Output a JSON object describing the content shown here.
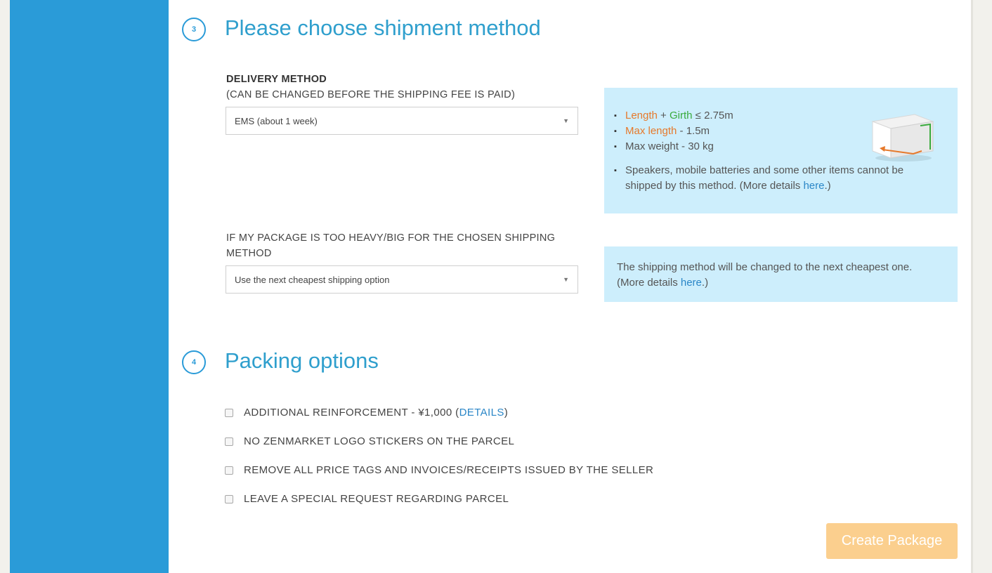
{
  "step3": {
    "number": "3",
    "title": "Please choose shipment method",
    "delivery_label": "DELIVERY METHOD",
    "delivery_sublabel": "(CAN BE CHANGED BEFORE THE SHIPPING FEE IS PAID)",
    "delivery_value": "EMS (about 1 week)",
    "info": {
      "length": "Length",
      "plus": " + ",
      "girth": "Girth",
      "length_girth_value": " ≤ 2.75m",
      "max_length_label": "Max length",
      "max_length_value": " -  1.5m",
      "max_weight": "Max weight - 30 kg",
      "restriction_text": "Speakers, mobile batteries and some other items cannot be shipped by this method. (More details ",
      "restriction_link": "here",
      "restriction_end": ".)"
    },
    "overweight_label": "IF MY PACKAGE IS TOO HEAVY/BIG FOR THE CHOSEN SHIPPING METHOD",
    "overweight_value": "Use the next cheapest shipping option",
    "overweight_info_text": "The shipping method will be changed to the next cheapest one. (More details ",
    "overweight_info_link": "here",
    "overweight_info_end": ".)"
  },
  "step4": {
    "number": "4",
    "title": "Packing options",
    "options": [
      {
        "label": "ADDITIONAL REINFORCEMENT - ¥1,000 (",
        "link": "DETAILS",
        "end": ")"
      },
      {
        "label": "NO ZENMARKET LOGO STICKERS ON THE PARCEL"
      },
      {
        "label": "REMOVE ALL PRICE TAGS AND INVOICES/RECEIPTS ISSUED BY THE SELLER"
      },
      {
        "label": "LEAVE A SPECIAL REQUEST REGARDING PARCEL"
      }
    ]
  },
  "create_button": "Create Package",
  "icons": {
    "package_box": "package-box-icon",
    "dropdown": "chevron-down-icon"
  },
  "colors": {
    "sidebar": "#2a9bd8",
    "heading": "#2f9fcd",
    "info_bg": "#cdeefc",
    "button": "#fbcf8e",
    "orange": "#e6792b",
    "green": "#3aab3d"
  }
}
